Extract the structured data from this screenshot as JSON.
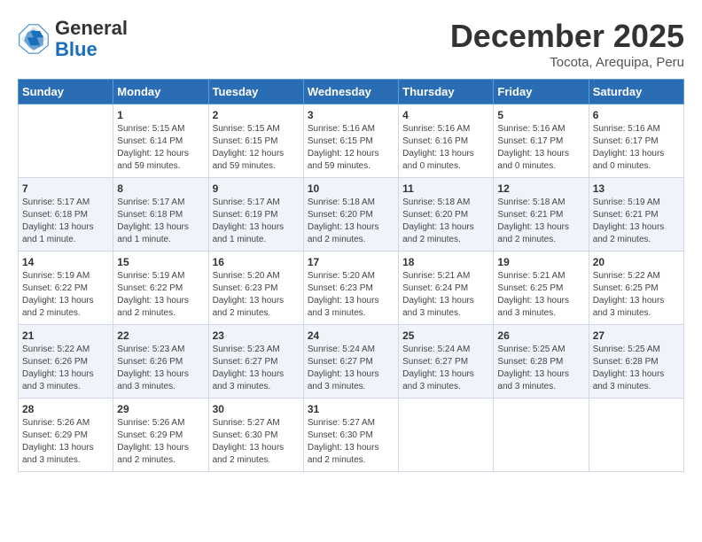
{
  "logo": {
    "general": "General",
    "blue": "Blue"
  },
  "header": {
    "month": "December 2025",
    "location": "Tocota, Arequipa, Peru"
  },
  "days": [
    "Sunday",
    "Monday",
    "Tuesday",
    "Wednesday",
    "Thursday",
    "Friday",
    "Saturday"
  ],
  "weeks": [
    [
      {
        "day": "",
        "info": ""
      },
      {
        "day": "1",
        "info": "Sunrise: 5:15 AM\nSunset: 6:14 PM\nDaylight: 12 hours\nand 59 minutes."
      },
      {
        "day": "2",
        "info": "Sunrise: 5:15 AM\nSunset: 6:15 PM\nDaylight: 12 hours\nand 59 minutes."
      },
      {
        "day": "3",
        "info": "Sunrise: 5:16 AM\nSunset: 6:15 PM\nDaylight: 12 hours\nand 59 minutes."
      },
      {
        "day": "4",
        "info": "Sunrise: 5:16 AM\nSunset: 6:16 PM\nDaylight: 13 hours\nand 0 minutes."
      },
      {
        "day": "5",
        "info": "Sunrise: 5:16 AM\nSunset: 6:17 PM\nDaylight: 13 hours\nand 0 minutes."
      },
      {
        "day": "6",
        "info": "Sunrise: 5:16 AM\nSunset: 6:17 PM\nDaylight: 13 hours\nand 0 minutes."
      }
    ],
    [
      {
        "day": "7",
        "info": "Sunrise: 5:17 AM\nSunset: 6:18 PM\nDaylight: 13 hours\nand 1 minute."
      },
      {
        "day": "8",
        "info": "Sunrise: 5:17 AM\nSunset: 6:18 PM\nDaylight: 13 hours\nand 1 minute."
      },
      {
        "day": "9",
        "info": "Sunrise: 5:17 AM\nSunset: 6:19 PM\nDaylight: 13 hours\nand 1 minute."
      },
      {
        "day": "10",
        "info": "Sunrise: 5:18 AM\nSunset: 6:20 PM\nDaylight: 13 hours\nand 2 minutes."
      },
      {
        "day": "11",
        "info": "Sunrise: 5:18 AM\nSunset: 6:20 PM\nDaylight: 13 hours\nand 2 minutes."
      },
      {
        "day": "12",
        "info": "Sunrise: 5:18 AM\nSunset: 6:21 PM\nDaylight: 13 hours\nand 2 minutes."
      },
      {
        "day": "13",
        "info": "Sunrise: 5:19 AM\nSunset: 6:21 PM\nDaylight: 13 hours\nand 2 minutes."
      }
    ],
    [
      {
        "day": "14",
        "info": "Sunrise: 5:19 AM\nSunset: 6:22 PM\nDaylight: 13 hours\nand 2 minutes."
      },
      {
        "day": "15",
        "info": "Sunrise: 5:19 AM\nSunset: 6:22 PM\nDaylight: 13 hours\nand 2 minutes."
      },
      {
        "day": "16",
        "info": "Sunrise: 5:20 AM\nSunset: 6:23 PM\nDaylight: 13 hours\nand 2 minutes."
      },
      {
        "day": "17",
        "info": "Sunrise: 5:20 AM\nSunset: 6:23 PM\nDaylight: 13 hours\nand 3 minutes."
      },
      {
        "day": "18",
        "info": "Sunrise: 5:21 AM\nSunset: 6:24 PM\nDaylight: 13 hours\nand 3 minutes."
      },
      {
        "day": "19",
        "info": "Sunrise: 5:21 AM\nSunset: 6:25 PM\nDaylight: 13 hours\nand 3 minutes."
      },
      {
        "day": "20",
        "info": "Sunrise: 5:22 AM\nSunset: 6:25 PM\nDaylight: 13 hours\nand 3 minutes."
      }
    ],
    [
      {
        "day": "21",
        "info": "Sunrise: 5:22 AM\nSunset: 6:26 PM\nDaylight: 13 hours\nand 3 minutes."
      },
      {
        "day": "22",
        "info": "Sunrise: 5:23 AM\nSunset: 6:26 PM\nDaylight: 13 hours\nand 3 minutes."
      },
      {
        "day": "23",
        "info": "Sunrise: 5:23 AM\nSunset: 6:27 PM\nDaylight: 13 hours\nand 3 minutes."
      },
      {
        "day": "24",
        "info": "Sunrise: 5:24 AM\nSunset: 6:27 PM\nDaylight: 13 hours\nand 3 minutes."
      },
      {
        "day": "25",
        "info": "Sunrise: 5:24 AM\nSunset: 6:27 PM\nDaylight: 13 hours\nand 3 minutes."
      },
      {
        "day": "26",
        "info": "Sunrise: 5:25 AM\nSunset: 6:28 PM\nDaylight: 13 hours\nand 3 minutes."
      },
      {
        "day": "27",
        "info": "Sunrise: 5:25 AM\nSunset: 6:28 PM\nDaylight: 13 hours\nand 3 minutes."
      }
    ],
    [
      {
        "day": "28",
        "info": "Sunrise: 5:26 AM\nSunset: 6:29 PM\nDaylight: 13 hours\nand 3 minutes."
      },
      {
        "day": "29",
        "info": "Sunrise: 5:26 AM\nSunset: 6:29 PM\nDaylight: 13 hours\nand 2 minutes."
      },
      {
        "day": "30",
        "info": "Sunrise: 5:27 AM\nSunset: 6:30 PM\nDaylight: 13 hours\nand 2 minutes."
      },
      {
        "day": "31",
        "info": "Sunrise: 5:27 AM\nSunset: 6:30 PM\nDaylight: 13 hours\nand 2 minutes."
      },
      {
        "day": "",
        "info": ""
      },
      {
        "day": "",
        "info": ""
      },
      {
        "day": "",
        "info": ""
      }
    ]
  ]
}
